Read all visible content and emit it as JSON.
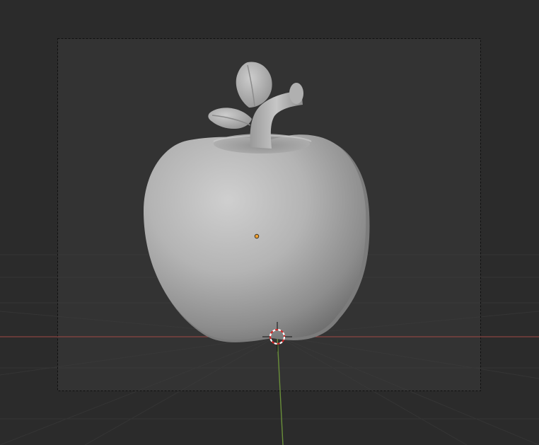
{
  "viewport": {
    "background_color": "#2b2b2b",
    "camera_frame_fill_color": "#3a3a3a",
    "camera_frame_border_color": "#101010",
    "grid_line_color": "#353535",
    "x_axis_color": "#a04a46",
    "y_axis_color": "#6a8f3a"
  },
  "object": {
    "model": "apple",
    "material_color": "#b9b9b9",
    "origin_color": "#f0a030"
  },
  "cursor_3d": {
    "icon": "3d-cursor-icon",
    "ring_primary_color": "#ffffff",
    "ring_secondary_color": "#d22a2a"
  }
}
